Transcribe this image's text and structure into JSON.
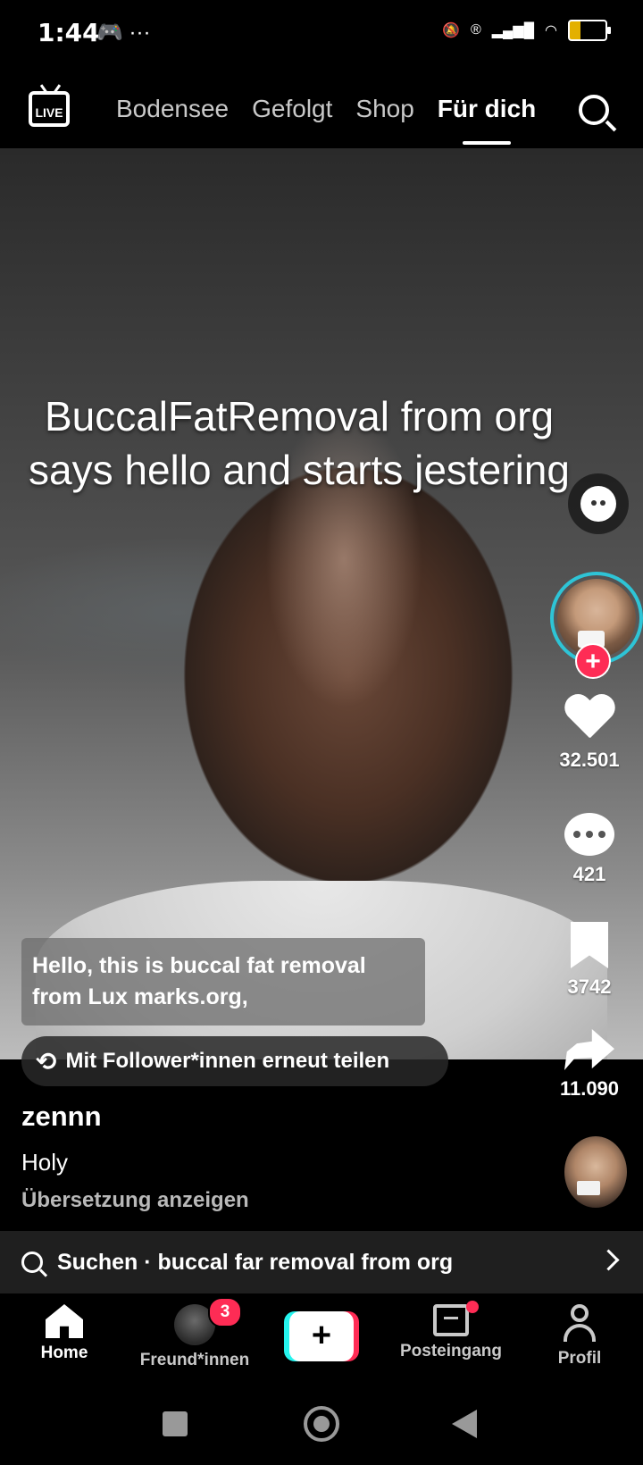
{
  "status_bar": {
    "time": "1:44",
    "left_icons": "🎮 ···",
    "battery": "21"
  },
  "top_nav": {
    "live_label": "LIVE",
    "tabs": [
      {
        "label": "Bodensee",
        "active": false
      },
      {
        "label": "Gefolgt",
        "active": false
      },
      {
        "label": "Shop",
        "active": false
      },
      {
        "label": "Für dich",
        "active": true
      }
    ]
  },
  "video": {
    "title": "BuccalFatRemoval from org says hello and starts jestering",
    "caption": "Hello, this is buccal fat removal from Lux marks.org,",
    "repost_label": "Mit Follower*innen erneut teilen"
  },
  "right_rail": {
    "likes": "32.501",
    "comments": "421",
    "saves": "3742",
    "shares": "11.090",
    "follow_plus": "+"
  },
  "post": {
    "username": "zennn",
    "description": "Holy",
    "translate_label": "Übersetzung anzeigen"
  },
  "search_bar": {
    "text": "Suchen · buccal far removal from org"
  },
  "bottom_nav": {
    "items": [
      {
        "label": "Home"
      },
      {
        "label": "Freund*innen",
        "badge": "3"
      },
      {
        "label": "+"
      },
      {
        "label": "Posteingang"
      },
      {
        "label": "Profil"
      }
    ]
  },
  "colors": {
    "accent_red": "#fe2c55",
    "accent_cyan": "#25f4ee",
    "avatar_ring": "#2ec4d6"
  }
}
